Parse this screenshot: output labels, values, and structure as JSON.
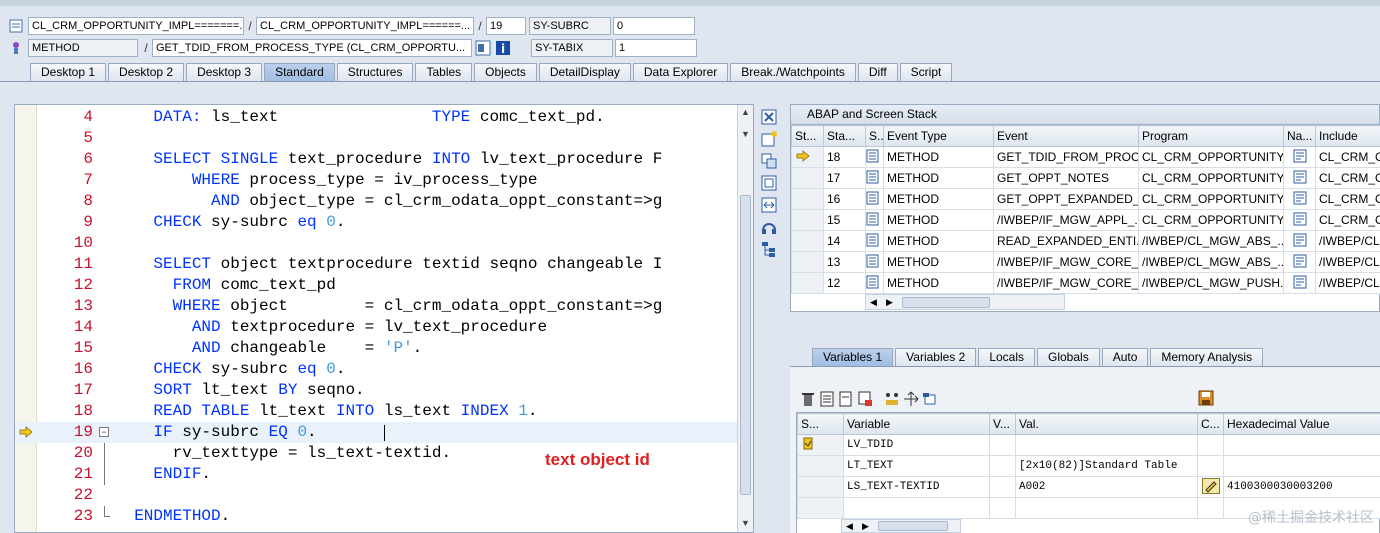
{
  "header": {
    "row1": {
      "class1": "CL_CRM_OPPORTUNITY_IMPL=======...",
      "class2": "CL_CRM_OPPORTUNITY_IMPL======...",
      "line": "19",
      "sysvar_name": "SY-SUBRC",
      "sysvar_value": "0"
    },
    "row2": {
      "type": "METHOD",
      "method": "GET_TDID_FROM_PROCESS_TYPE (CL_CRM_OPPORTU...",
      "sysvar_name": "SY-TABIX",
      "sysvar_value": "1"
    }
  },
  "tabs": [
    "Desktop 1",
    "Desktop 2",
    "Desktop 3",
    "Standard",
    "Structures",
    "Tables",
    "Objects",
    "DetailDisplay",
    "Data Explorer",
    "Break./Watchpoints",
    "Diff",
    "Script"
  ],
  "active_tab": "Standard",
  "code": [
    {
      "n": "4",
      "t": [
        [
          "    ",
          ""
        ],
        [
          "DATA:",
          "kw"
        ],
        [
          " ls_text                ",
          ""
        ],
        [
          "TYPE",
          "kw"
        ],
        [
          " comc_text_pd.",
          ""
        ]
      ]
    },
    {
      "n": "5",
      "t": []
    },
    {
      "n": "6",
      "t": [
        [
          "    ",
          ""
        ],
        [
          "SELECT SINGLE",
          "kw"
        ],
        [
          " text_procedure ",
          ""
        ],
        [
          "INTO",
          "kw"
        ],
        [
          " lv_text_procedure F",
          ""
        ]
      ]
    },
    {
      "n": "7",
      "t": [
        [
          "        ",
          ""
        ],
        [
          "WHERE",
          "kw"
        ],
        [
          " process_type = iv_process_type",
          ""
        ]
      ]
    },
    {
      "n": "8",
      "t": [
        [
          "          ",
          ""
        ],
        [
          "AND",
          "kw"
        ],
        [
          " object_type = cl_crm_odata_oppt_constant=>g",
          ""
        ]
      ]
    },
    {
      "n": "9",
      "t": [
        [
          "    ",
          ""
        ],
        [
          "CHECK",
          "kw"
        ],
        [
          " sy-subrc ",
          ""
        ],
        [
          "eq",
          "kw"
        ],
        [
          " ",
          ""
        ],
        [
          "0",
          "num"
        ],
        [
          ".",
          ""
        ]
      ]
    },
    {
      "n": "10",
      "t": []
    },
    {
      "n": "11",
      "t": [
        [
          "    ",
          ""
        ],
        [
          "SELECT",
          "kw"
        ],
        [
          " object textprocedure textid seqno changeable I",
          ""
        ]
      ]
    },
    {
      "n": "12",
      "t": [
        [
          "      ",
          ""
        ],
        [
          "FROM",
          "kw"
        ],
        [
          " comc_text_pd",
          ""
        ]
      ]
    },
    {
      "n": "13",
      "t": [
        [
          "      ",
          ""
        ],
        [
          "WHERE",
          "kw"
        ],
        [
          " object        = cl_crm_odata_oppt_constant=>g",
          ""
        ]
      ]
    },
    {
      "n": "14",
      "t": [
        [
          "        ",
          ""
        ],
        [
          "AND",
          "kw"
        ],
        [
          " textprocedure = lv_text_procedure",
          ""
        ]
      ]
    },
    {
      "n": "15",
      "t": [
        [
          "        ",
          ""
        ],
        [
          "AND",
          "kw"
        ],
        [
          " changeable    = ",
          ""
        ],
        [
          "'P'",
          "str"
        ],
        [
          ".",
          ""
        ]
      ]
    },
    {
      "n": "16",
      "t": [
        [
          "    ",
          ""
        ],
        [
          "CHECK",
          "kw"
        ],
        [
          " sy-subrc ",
          ""
        ],
        [
          "eq",
          "kw"
        ],
        [
          " ",
          ""
        ],
        [
          "0",
          "num"
        ],
        [
          ".",
          ""
        ]
      ]
    },
    {
      "n": "17",
      "t": [
        [
          "    ",
          ""
        ],
        [
          "SORT",
          "kw"
        ],
        [
          " lt_text ",
          ""
        ],
        [
          "BY",
          "kw"
        ],
        [
          " seqno.",
          ""
        ]
      ]
    },
    {
      "n": "18",
      "t": [
        [
          "    ",
          ""
        ],
        [
          "READ TABLE",
          "kw"
        ],
        [
          " lt_text ",
          ""
        ],
        [
          "INTO",
          "kw"
        ],
        [
          " ls_text ",
          ""
        ],
        [
          "INDEX",
          "kw"
        ],
        [
          " ",
          ""
        ],
        [
          "1",
          "num"
        ],
        [
          ".",
          ""
        ]
      ]
    },
    {
      "n": "19",
      "t": [
        [
          "    ",
          ""
        ],
        [
          "IF",
          "kw"
        ],
        [
          " sy-subrc ",
          ""
        ],
        [
          "EQ",
          "kw"
        ],
        [
          " ",
          ""
        ],
        [
          "0",
          "num"
        ],
        [
          ".",
          ""
        ]
      ]
    },
    {
      "n": "20",
      "t": [
        [
          "      rv_texttype = ls_text-textid.",
          ""
        ]
      ]
    },
    {
      "n": "21",
      "t": [
        [
          "    ",
          ""
        ],
        [
          "ENDIF",
          "kw"
        ],
        [
          ".",
          ""
        ]
      ]
    },
    {
      "n": "22",
      "t": []
    },
    {
      "n": "23",
      "t": [
        [
          "  ",
          ""
        ],
        [
          "ENDMETHOD",
          "kw"
        ],
        [
          ".",
          ""
        ]
      ]
    }
  ],
  "current_line": "19",
  "annotation": "text object id",
  "stack": {
    "title": "ABAP and Screen Stack",
    "columns": [
      "St...",
      "Sta...",
      "S...",
      "Event Type",
      "Event",
      "Program",
      "Na...",
      "Include"
    ],
    "rows": [
      {
        "level": "18",
        "type": "METHOD",
        "event": "GET_TDID_FROM_PROC...",
        "program": "CL_CRM_OPPORTUNITY...",
        "include": "CL_CRM_OP",
        "current": true
      },
      {
        "level": "17",
        "type": "METHOD",
        "event": "GET_OPPT_NOTES",
        "program": "CL_CRM_OPPORTUNITY...",
        "include": "CL_CRM_OP",
        "current": false
      },
      {
        "level": "16",
        "type": "METHOD",
        "event": "GET_OPPT_EXPANDED_...",
        "program": "CL_CRM_OPPORTUNITY...",
        "include": "CL_CRM_OP",
        "current": false
      },
      {
        "level": "15",
        "type": "METHOD",
        "event": "/IWBEP/IF_MGW_APPL_...",
        "program": "CL_CRM_OPPORTUNITY...",
        "include": "CL_CRM_OP",
        "current": false
      },
      {
        "level": "14",
        "type": "METHOD",
        "event": "READ_EXPANDED_ENTI...",
        "program": "/IWBEP/CL_MGW_ABS_...",
        "include": "/IWBEP/CL",
        "current": false
      },
      {
        "level": "13",
        "type": "METHOD",
        "event": "/IWBEP/IF_MGW_CORE_...",
        "program": "/IWBEP/CL_MGW_ABS_...",
        "include": "/IWBEP/CL",
        "current": false
      },
      {
        "level": "12",
        "type": "METHOD",
        "event": "/IWBEP/IF_MGW_CORE_...",
        "program": "/IWBEP/CL_MGW_PUSH...",
        "include": "/IWBEP/CL",
        "current": false
      }
    ]
  },
  "var_tabs": [
    "Variables 1",
    "Variables 2",
    "Locals",
    "Globals",
    "Auto",
    "Memory Analysis"
  ],
  "active_var_tab": "Variables 1",
  "vars": {
    "columns": [
      "S...",
      "Variable",
      "V...",
      "Val.",
      "C...",
      "Hexadecimal Value"
    ],
    "rows": [
      {
        "variable": "LV_TDID",
        "value": "",
        "hex": "",
        "edit": false
      },
      {
        "variable": "LT_TEXT",
        "value": "[2x10(82)]Standard Table",
        "hex": "",
        "edit": false
      },
      {
        "variable": "LS_TEXT-TEXTID",
        "value": "A002",
        "hex": "4100300030003200",
        "edit": true
      }
    ]
  },
  "watermark": "@稀土掘金技术社区"
}
